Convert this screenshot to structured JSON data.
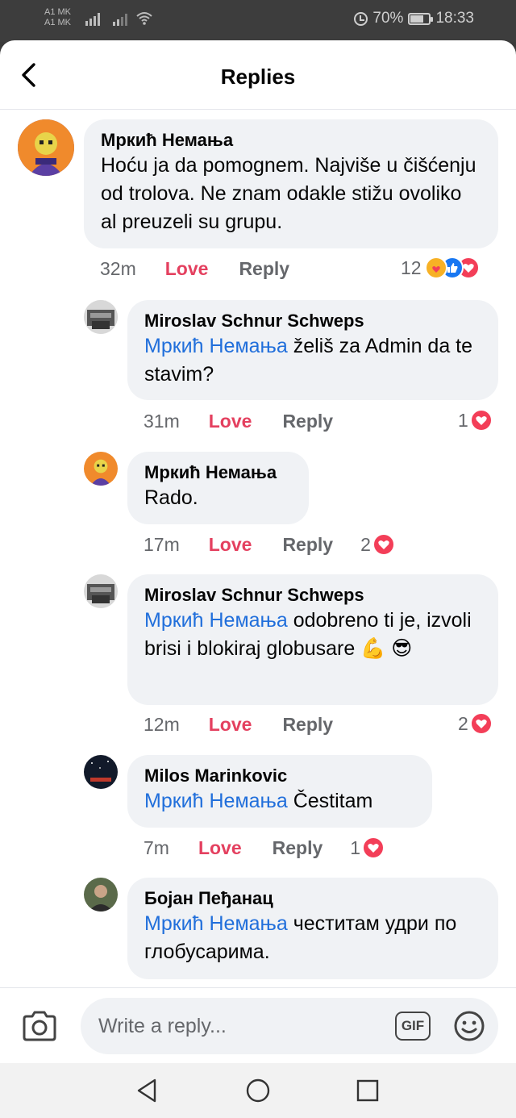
{
  "status_bar": {
    "carrier_1": "A1 MK",
    "carrier_2": "A1 MK",
    "battery": "70%",
    "time": "18:33"
  },
  "header": {
    "title": "Replies"
  },
  "comments": [
    {
      "author": "Мркић Немања",
      "mention": "",
      "text": "Hoću ja da pomognem. Najviše u čišćenju od trolova. Ne znam odakle stižu ovoliko al preuzeli su grupu.",
      "time": "32m",
      "love": "Love",
      "reply": "Reply",
      "reaction_count": "12"
    },
    {
      "author": "Miroslav Schnur Schweps",
      "mention": "Мркић Немања",
      "text": " želiš za Admin da te stavim?",
      "time": "31m",
      "love": "Love",
      "reply": "Reply",
      "reaction_count": "1"
    },
    {
      "author": "Мркић Немања",
      "mention": "",
      "text": "Rado.",
      "time": "17m",
      "love": "Love",
      "reply": "Reply",
      "reaction_count": "2"
    },
    {
      "author": "Miroslav Schnur Schweps",
      "mention": "Мркић Немања",
      "text": " odobreno ti je, izvoli brisi i blokiraj globusare ",
      "emoji_1": "💪",
      "emoji_2": "😎",
      "time": "12m",
      "love": "Love",
      "reply": "Reply",
      "reaction_count": "2"
    },
    {
      "author": "Milos Marinkovic",
      "mention": "Мркић Немања",
      "text": " Čestitam",
      "time": "7m",
      "love": "Love",
      "reply": "Reply",
      "reaction_count": "1"
    },
    {
      "author": "Бојан Пеђанац",
      "mention": "Мркић Немања",
      "text": " честитам удри по глобусарима."
    }
  ],
  "composer": {
    "placeholder": "Write a reply...",
    "gif_label": "GIF"
  },
  "colors": {
    "mention": "#216fdb",
    "love": "#e4405f",
    "bubble": "#f0f2f5"
  }
}
